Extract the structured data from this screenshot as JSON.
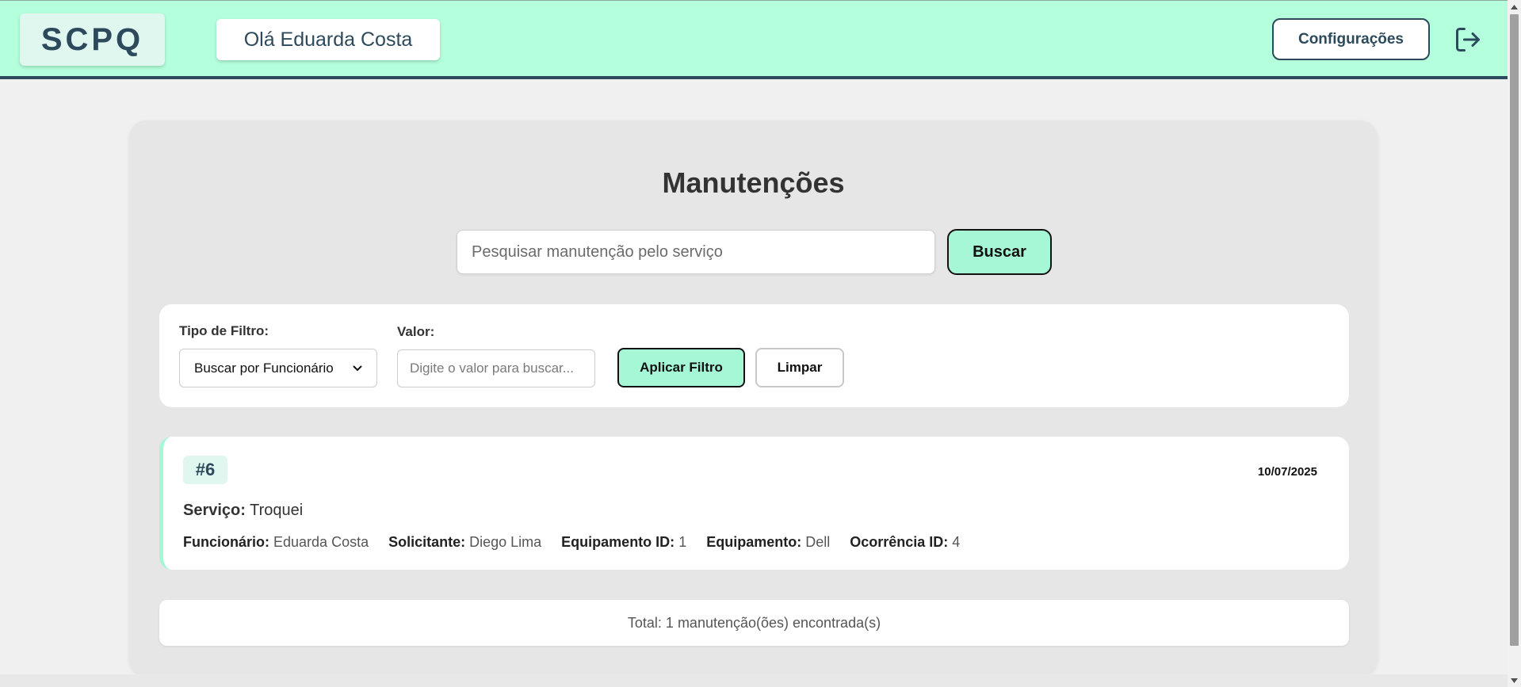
{
  "header": {
    "logo": "SCPQ",
    "greeting": "Olá Eduarda Costa",
    "config_label": "Configurações"
  },
  "main": {
    "title": "Manutenções",
    "search": {
      "placeholder": "Pesquisar manutenção pelo serviço",
      "button_label": "Buscar"
    },
    "filter": {
      "type_label": "Tipo de Filtro:",
      "selected_option": "Buscar por Funcionário",
      "value_label": "Valor:",
      "value_placeholder": "Digite o valor para buscar...",
      "apply_label": "Aplicar Filtro",
      "clear_label": "Limpar"
    },
    "items": [
      {
        "id": "#6",
        "date": "10/07/2025",
        "service_label": "Serviço:",
        "service": "Troquei",
        "details": [
          {
            "label": "Funcionário:",
            "value": "Eduarda Costa"
          },
          {
            "label": "Solicitante:",
            "value": "Diego Lima"
          },
          {
            "label": "Equipamento ID:",
            "value": "1"
          },
          {
            "label": "Equipamento:",
            "value": "Dell"
          },
          {
            "label": "Ocorrência ID:",
            "value": "4"
          }
        ]
      }
    ],
    "total": "Total: 1 manutenção(ões) encontrada(s)"
  },
  "colors": {
    "header_bg": "#b4ffdc",
    "header_border": "#2c4a5c",
    "accent": "#a6f7d6",
    "brand_text": "#2c4a5c"
  }
}
